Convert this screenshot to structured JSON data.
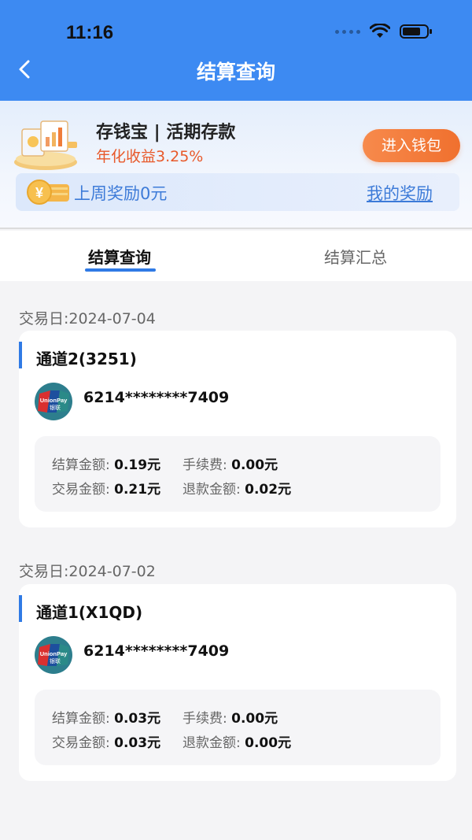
{
  "status": {
    "time": "11:16"
  },
  "header": {
    "title": "结算查询"
  },
  "promo": {
    "title": "存钱宝 | 活期存款",
    "rate": "年化收益3.25%",
    "button": "进入钱包",
    "reward_text": "上周奖励0元",
    "reward_link": "我的奖励"
  },
  "tabs": [
    {
      "label": "结算查询",
      "active": true
    },
    {
      "label": "结算汇总",
      "active": false
    }
  ],
  "records": [
    {
      "date_label": "交易日:2024-07-04",
      "channel": "通道2(3251)",
      "card": "6214********7409",
      "settle_label": "结算金额:",
      "settle_value": "0.19元",
      "fee_label": "手续费:",
      "fee_value": "0.00元",
      "trade_label": "交易金额:",
      "trade_value": "0.21元",
      "refund_label": "退款金额:",
      "refund_value": "0.02元"
    },
    {
      "date_label": "交易日:2024-07-02",
      "channel": "通道1(X1QD)",
      "card": "6214********7409",
      "settle_label": "结算金额:",
      "settle_value": "0.03元",
      "fee_label": "手续费:",
      "fee_value": "0.00元",
      "trade_label": "交易金额:",
      "trade_value": "0.03元",
      "refund_label": "退款金额:",
      "refund_value": "0.00元"
    }
  ],
  "icons": {
    "back": "chevron-left-icon",
    "wifi": "wifi-icon",
    "battery": "battery-icon",
    "bank": "unionpay-icon"
  },
  "colors": {
    "header_bg": "#3d8af2",
    "accent": "#2f7ae5",
    "rate_orange": "#e8592a",
    "button_orange": "#f0702e"
  }
}
